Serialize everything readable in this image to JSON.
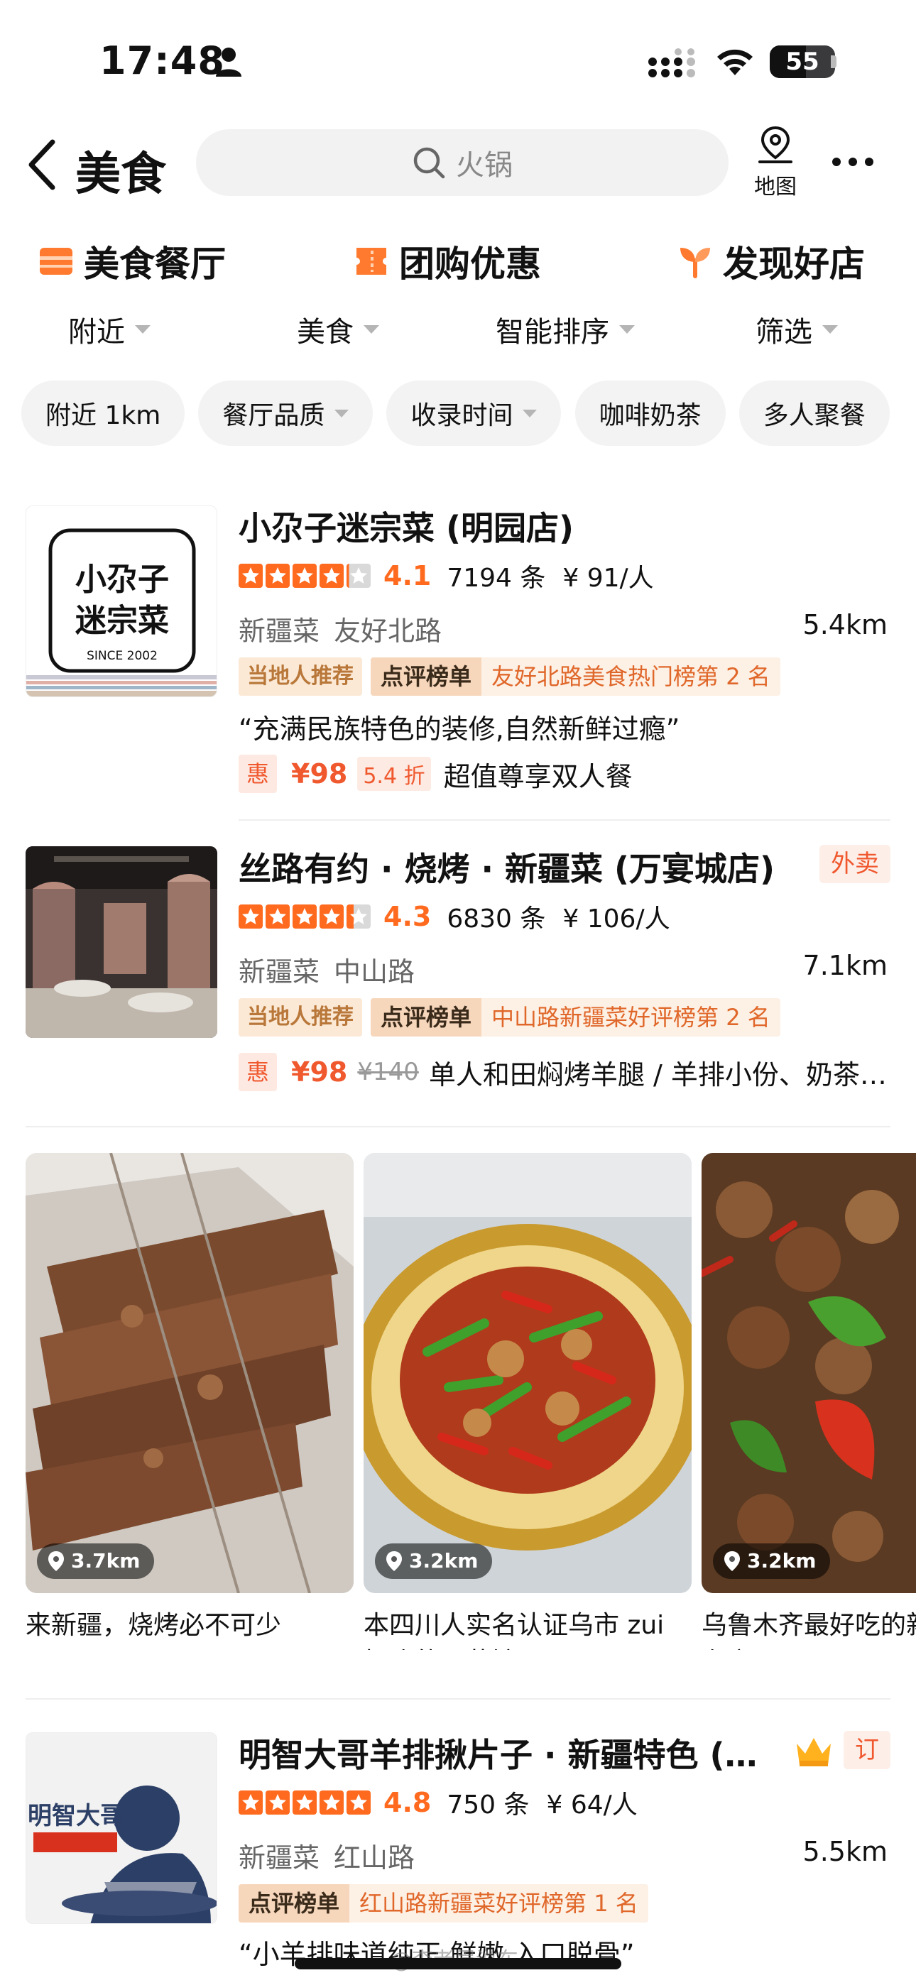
{
  "status_bar": {
    "time": "17:48",
    "battery": "55",
    "battery_level": 0.55
  },
  "header": {
    "title": "美食",
    "search_placeholder": "火锅",
    "map_label": "地图"
  },
  "category_tabs": [
    {
      "label": "美食餐厅",
      "icon": "storefront-icon",
      "color": "#ff7a2e",
      "active": true
    },
    {
      "label": "团购优惠",
      "icon": "coupon-icon",
      "color": "#ff7a2e",
      "active": false
    },
    {
      "label": "发现好店",
      "icon": "sprout-icon",
      "color": "#ff7a2e",
      "active": false
    }
  ],
  "sort_bar": [
    "附近",
    "美食",
    "智能排序",
    "筛选"
  ],
  "filter_chips": [
    {
      "label": "附近 1km",
      "dropdown": false
    },
    {
      "label": "餐厅品质",
      "dropdown": true
    },
    {
      "label": "收录时间",
      "dropdown": true
    },
    {
      "label": "咖啡奶茶",
      "dropdown": false
    },
    {
      "label": "多人聚餐",
      "dropdown": false
    }
  ],
  "restaurants": [
    {
      "name": "小尕子迷宗菜 (明园店)",
      "logo_text": "小尕子迷宗菜",
      "logo_sub": "SINCE 2002",
      "rating": 4.1,
      "rating_text": "4.1",
      "reviews": "7194 条",
      "price": "¥ 91/人",
      "tags": [
        "新疆菜",
        "友好北路"
      ],
      "distance": "5.4km",
      "local_pick": "当地人推荐",
      "rank_label": "点评榜单",
      "rank_text": "友好北路美食热门榜第 2 名",
      "quote": "“充满民族特色的装修,自然新鲜过瘾”",
      "deal": {
        "tag": "惠",
        "price": "¥98",
        "discount": "5.4 折",
        "original": "",
        "desc": "超值尊享双人餐"
      }
    },
    {
      "name": "丝路有约 · 烧烤 · 新疆菜 (万宴城店)",
      "badge": "外卖",
      "rating": 4.3,
      "rating_text": "4.3",
      "reviews": "6830 条",
      "price": "¥ 106/人",
      "tags": [
        "新疆菜",
        "中山路"
      ],
      "distance": "7.1km",
      "local_pick": "当地人推荐",
      "rank_label": "点评榜单",
      "rank_text": "中山路新疆菜好评榜第 2 名",
      "deal": {
        "tag": "惠",
        "price": "¥98",
        "discount": "",
        "original": "¥140",
        "desc": "单人和田焖烤羊腿 / 羊排小份、奶茶 / …"
      }
    },
    {
      "name": "明智大哥羊排揪片子 · 新疆特色 (…",
      "badge": "订",
      "crown_icon": "crown-icon",
      "logo_text": "明智大哥",
      "rating": 4.8,
      "rating_text": "4.8",
      "reviews": "750 条",
      "price": "¥ 64/人",
      "tags": [
        "新疆菜",
        "红山路"
      ],
      "distance": "5.5km",
      "rank_label": "点评榜单",
      "rank_text": "红山路新疆菜好评榜第 1 名",
      "quote": "“小羊排味道纯正,鲜嫩,入口脱骨”"
    }
  ],
  "photo_posts": [
    {
      "distance": "3.7km",
      "caption": "来新疆，烧烤必不可少"
    },
    {
      "distance": "3.2km",
      "caption": "本四川人实名认证乌市 zui 好吃的川菜馆! ! ! !"
    },
    {
      "distance": "3.2km",
      "caption": "乌鲁木齐最好吃的新疆菜没有之一"
    }
  ],
  "watermark": "@李老眉说车",
  "colors": {
    "accent": "#ff6a1f",
    "star_on": "#ff6a1f",
    "star_off": "#d9d9d9"
  }
}
